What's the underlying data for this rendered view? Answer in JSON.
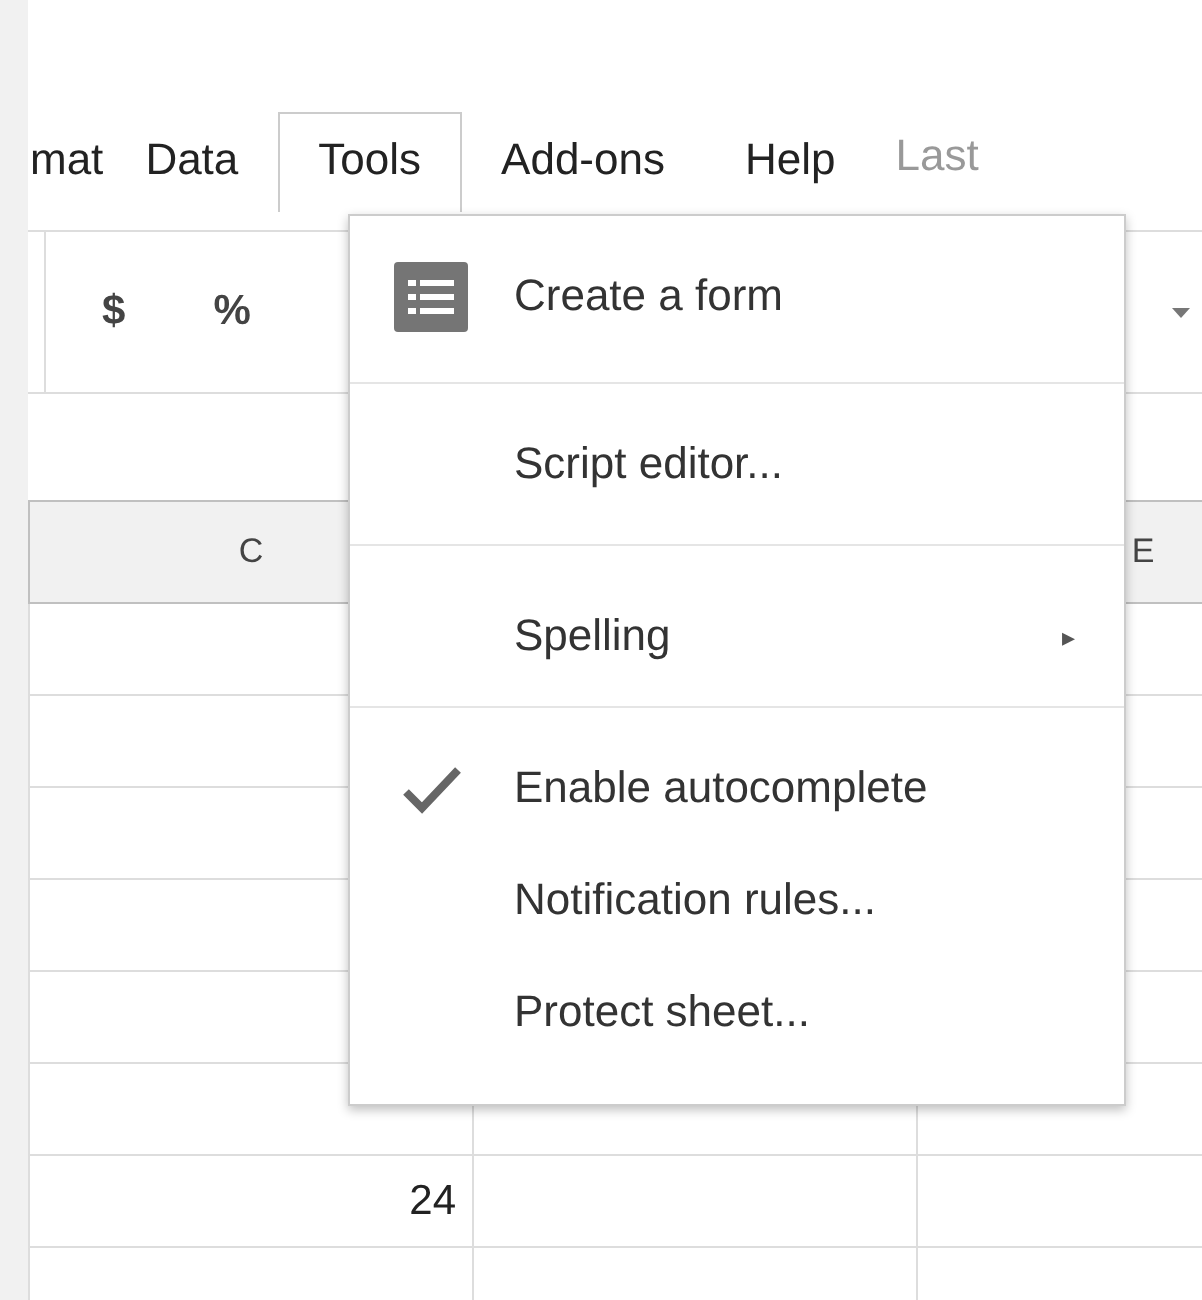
{
  "menu_bar": {
    "items": [
      {
        "label": "mat",
        "selected": false
      },
      {
        "label": "Data",
        "selected": false
      },
      {
        "label": "Tools",
        "selected": true
      },
      {
        "label": "Add-ons",
        "selected": false
      },
      {
        "label": "Help",
        "selected": false
      }
    ],
    "last_edit": "Last"
  },
  "toolbar": {
    "buttons": [
      "$",
      "%"
    ]
  },
  "sheet": {
    "columns": [
      {
        "label": "C"
      },
      {
        "label": "E"
      }
    ],
    "rows": [
      {},
      {},
      {},
      {},
      {},
      {},
      {
        "col_c": "24"
      },
      {}
    ]
  },
  "menu": {
    "groups": [
      [
        {
          "kind": "icon",
          "label": "Create a form"
        }
      ],
      [
        {
          "kind": "plain",
          "label": "Script editor..."
        }
      ],
      [
        {
          "kind": "submenu",
          "label": "Spelling",
          "arrow": "▸"
        }
      ],
      [
        {
          "kind": "toggle",
          "label": "Enable autocomplete",
          "checked": true
        },
        {
          "kind": "plain",
          "label": "Notification rules..."
        },
        {
          "kind": "plain",
          "label": "Protect sheet..."
        }
      ]
    ]
  }
}
